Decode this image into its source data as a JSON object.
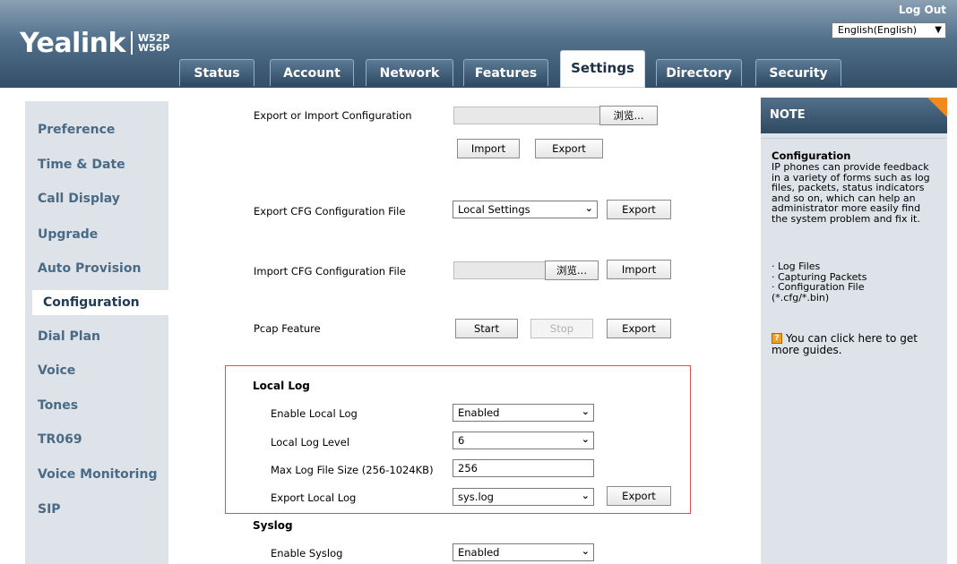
{
  "header": {
    "brand": "Yealink",
    "models": [
      "W52P",
      "W56P"
    ],
    "logout": "Log Out",
    "language": "English(English)"
  },
  "tabs": [
    {
      "label": "Status"
    },
    {
      "label": "Account"
    },
    {
      "label": "Network"
    },
    {
      "label": "Features"
    },
    {
      "label": "Settings",
      "active": true
    },
    {
      "label": "Directory"
    },
    {
      "label": "Security"
    }
  ],
  "sidebar": {
    "items": [
      {
        "label": "Preference"
      },
      {
        "label": "Time & Date"
      },
      {
        "label": "Call Display"
      },
      {
        "label": "Upgrade"
      },
      {
        "label": "Auto Provision"
      },
      {
        "label": "Configuration",
        "active": true
      },
      {
        "label": "Dial Plan"
      },
      {
        "label": "Voice"
      },
      {
        "label": "Tones"
      },
      {
        "label": "TR069"
      },
      {
        "label": "Voice Monitoring"
      },
      {
        "label": "SIP"
      }
    ]
  },
  "main": {
    "export_import": {
      "label": "Export or Import Configuration",
      "browse": "浏览...",
      "import": "Import",
      "export": "Export"
    },
    "export_cfg": {
      "label": "Export CFG Configuration File",
      "selected": "Local Settings",
      "export": "Export"
    },
    "import_cfg": {
      "label": "Import CFG Configuration File",
      "browse": "浏览...",
      "import": "Import"
    },
    "pcap": {
      "label": "Pcap Feature",
      "start": "Start",
      "stop": "Stop",
      "export": "Export"
    },
    "local_log": {
      "title": "Local Log",
      "enable_label": "Enable Local Log",
      "enable_value": "Enabled",
      "level_label": "Local Log Level",
      "level_value": "6",
      "size_label": "Max Log File Size (256-1024KB)",
      "size_value": "256",
      "export_label": "Export Local Log",
      "export_value": "sys.log",
      "export_button": "Export"
    },
    "syslog": {
      "title": "Syslog",
      "enable_label": "Enable Syslog",
      "enable_value": "Enabled"
    }
  },
  "note": {
    "title": "NOTE",
    "heading": "Configuration",
    "body": [
      "IP phones can provide feedback",
      "in a variety of forms such as log",
      "files, packets, status indicators",
      "and so on, which can help an",
      "administrator more easily find",
      "the system problem and fix it."
    ],
    "bullets": [
      "· Log Files",
      "· Capturing Packets",
      "· Configuration File",
      "(*.cfg/*.bin)"
    ],
    "guide": [
      "You can click here to get",
      "more guides."
    ]
  },
  "colors": {
    "header_dark": "#344e66",
    "panel_bg": "#dde3e8",
    "highlight_border": "#e05050",
    "note_corner": "#f08a1c"
  }
}
